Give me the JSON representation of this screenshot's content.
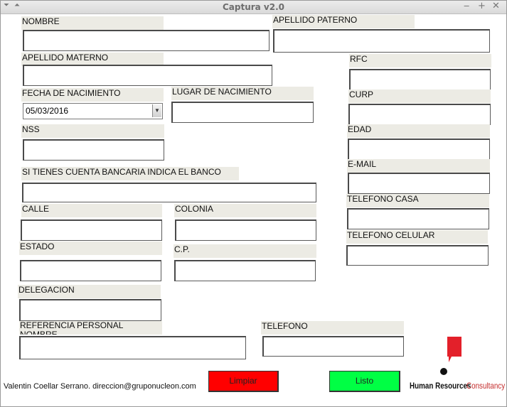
{
  "window": {
    "title": "Captura  v2.0"
  },
  "labels": {
    "nombre": "NOMBRE",
    "apellido_paterno": "APELLIDO PATERNO",
    "apellido_materno": "APELLIDO MATERNO",
    "rfc": "RFC",
    "fecha_nacimiento": "FECHA DE NACIMIENTO",
    "lugar_nacimiento": "LUGAR DE NACIMIENTO",
    "curp": "CURP",
    "nss": "NSS",
    "edad": "EDAD",
    "email": "E-MAIL",
    "banco": "SI TIENES CUENTA BANCARIA INDICA EL BANCO",
    "telefono_casa": "TELEFONO CASA",
    "calle": "CALLE",
    "colonia": "COLONIA",
    "telefono_celular": "TELEFONO CELULAR",
    "estado": "ESTADO",
    "cp": "C.P.",
    "delegacion": "DELEGACION",
    "referencia": "REFERENCIA PERSONAL\nNOMBRE",
    "telefono": "TELEFONO"
  },
  "fields": {
    "fecha_nacimiento_value": "05/03/2016"
  },
  "buttons": {
    "limpiar": "Limpiar",
    "listo": "Listo"
  },
  "footer": {
    "credit": "Valentin Coellar Serrano. direccion@gruponucleon.com"
  },
  "logo": {
    "text_bold": "Human Resources",
    "text_accent": "Consultancy"
  },
  "colors": {
    "limpiar_bg": "#ff0000",
    "listo_bg": "#00ff44",
    "label_bg": "#ecebe4",
    "logo_red": "#e3202a"
  }
}
